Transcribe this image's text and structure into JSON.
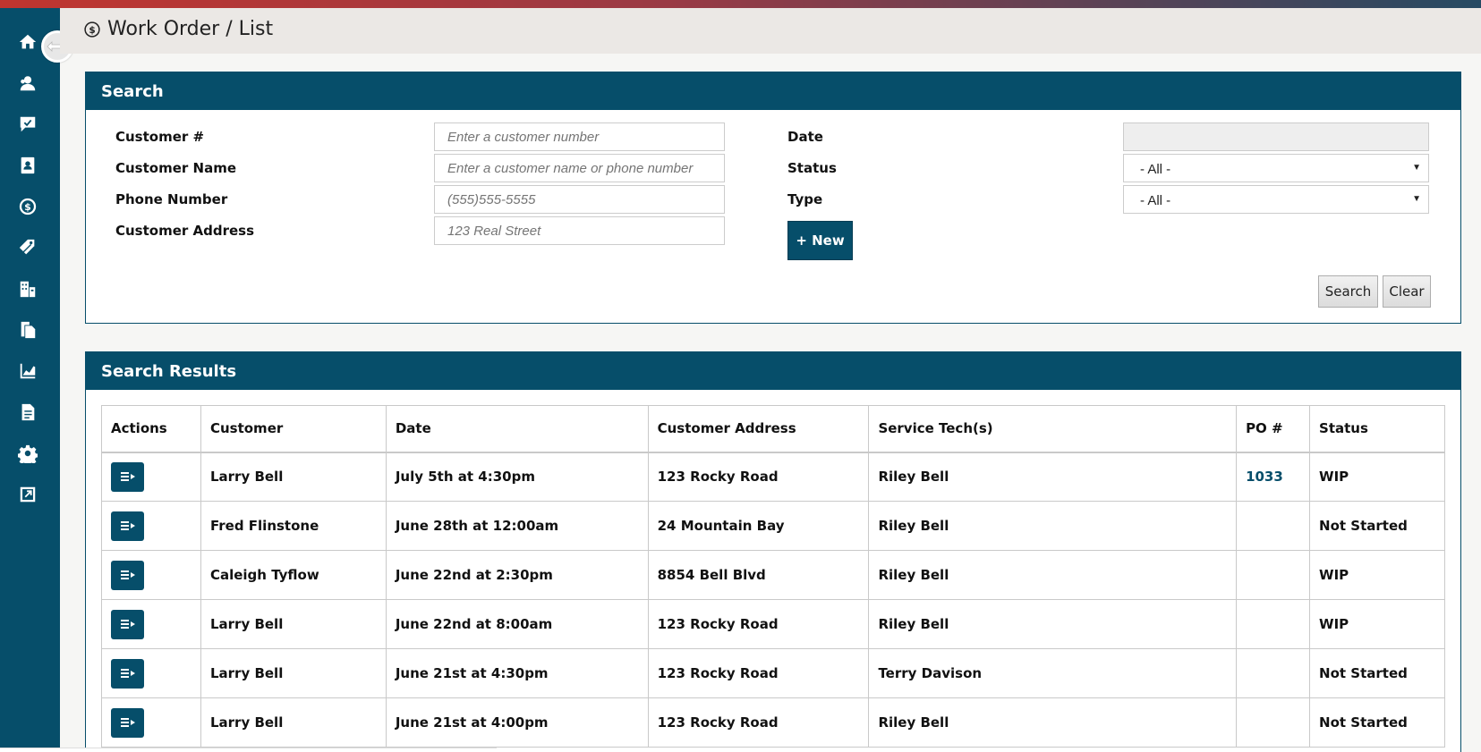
{
  "header": {
    "title": "Work Order / List",
    "icon": "dollar-circle-icon"
  },
  "sidebar": {
    "items": [
      {
        "icon": "home-icon"
      },
      {
        "icon": "customers-icon"
      },
      {
        "icon": "chat-check-icon"
      },
      {
        "icon": "contacts-book-icon"
      },
      {
        "icon": "dollar-circle-icon"
      },
      {
        "icon": "tags-icon"
      },
      {
        "icon": "buildings-icon"
      },
      {
        "icon": "documents-icon"
      },
      {
        "icon": "chart-icon"
      },
      {
        "icon": "file-icon"
      },
      {
        "icon": "gear-icon"
      },
      {
        "icon": "external-link-icon"
      }
    ],
    "toggle_icon": "expand-arrows-icon"
  },
  "search": {
    "title": "Search",
    "customer_number": {
      "label": "Customer #",
      "value": "",
      "placeholder": "Enter a customer number"
    },
    "customer_name": {
      "label": "Customer Name",
      "value": "",
      "placeholder": "Enter a customer name or phone number"
    },
    "phone_number": {
      "label": "Phone Number",
      "value": "",
      "placeholder": "(555)555-5555"
    },
    "customer_address": {
      "label": "Customer Address",
      "value": "",
      "placeholder": "123 Real Street"
    },
    "date": {
      "label": "Date",
      "value": ""
    },
    "status": {
      "label": "Status",
      "selected": "- All -"
    },
    "type": {
      "label": "Type",
      "selected": "- All -"
    },
    "new_button": "+ New",
    "search_button": "Search",
    "clear_button": "Clear"
  },
  "results": {
    "title": "Search Results",
    "columns": [
      "Actions",
      "Customer",
      "Date",
      "Customer Address",
      "Service Tech(s)",
      "PO #",
      "Status"
    ],
    "rows": [
      {
        "customer": "Larry Bell",
        "date": "July 5th at 4:30pm",
        "address": "123 Rocky Road",
        "tech": "Riley Bell",
        "po": "1033",
        "status": "WIP"
      },
      {
        "customer": "Fred Flinstone",
        "date": "June 28th at 12:00am",
        "address": "24 Mountain Bay",
        "tech": "Riley Bell",
        "po": "",
        "status": "Not Started"
      },
      {
        "customer": "Caleigh Tyflow",
        "date": "June 22nd at 2:30pm",
        "address": "8854 Bell Blvd",
        "tech": "Riley Bell",
        "po": "",
        "status": "WIP"
      },
      {
        "customer": "Larry Bell",
        "date": "June 22nd at 8:00am",
        "address": "123 Rocky Road",
        "tech": "Riley Bell",
        "po": "",
        "status": "WIP"
      },
      {
        "customer": "Larry Bell",
        "date": "June 21st at 4:30pm",
        "address": "123 Rocky Road",
        "tech": "Terry Davison",
        "po": "",
        "status": "Not Started"
      },
      {
        "customer": "Larry Bell",
        "date": "June 21st at 4:00pm",
        "address": "123 Rocky Road",
        "tech": "Riley Bell",
        "po": "",
        "status": "Not Started"
      }
    ]
  }
}
